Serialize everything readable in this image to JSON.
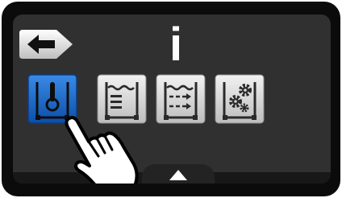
{
  "header": {
    "back_icon": "arrow-left-icon",
    "info_symbol": "i"
  },
  "tiles": [
    {
      "icon": "thermometer-icon",
      "selected": true
    },
    {
      "icon": "tank-level-icon",
      "selected": false
    },
    {
      "icon": "tank-circulation-icon",
      "selected": false
    },
    {
      "icon": "tank-settings-icon",
      "selected": false
    }
  ],
  "footer": {
    "up_icon": "chevron-up-icon"
  },
  "overlay": {
    "pointer_icon": "hand-pointer-icon"
  },
  "colors": {
    "screen": "#303030",
    "tile_normal": "#dcdcdc",
    "tile_selected": "#1565c8",
    "icon_dark": "#2a2a2a"
  }
}
